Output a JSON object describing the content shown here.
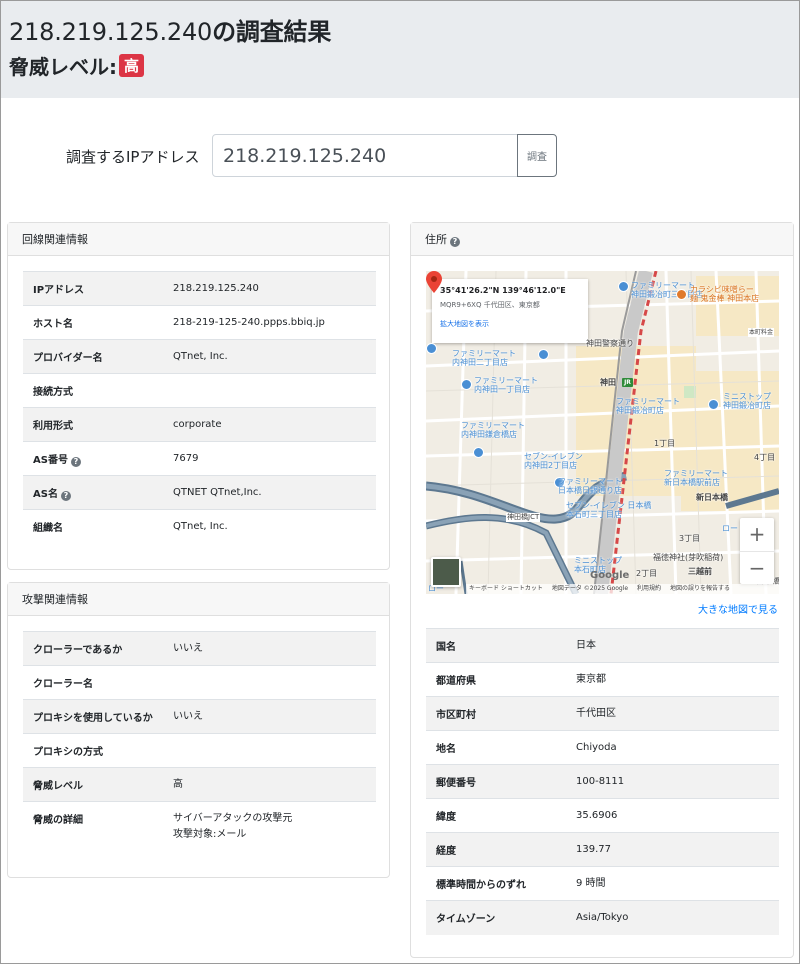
{
  "header": {
    "title_ip": "218.219.125.240",
    "title_suffix": "の調査結果",
    "threat_label": "脅威レベル:",
    "threat_badge": "高",
    "threat_badge_color": "#dc3545"
  },
  "search": {
    "label": "調査するIPアドレス",
    "value": "218.219.125.240",
    "button_label": "調査"
  },
  "line_info": {
    "title": "回線関連情報",
    "rows": [
      {
        "key": "IPアドレス",
        "value": "218.219.125.240"
      },
      {
        "key": "ホスト名",
        "value": "218-219-125-240.ppps.bbiq.jp"
      },
      {
        "key": "プロバイダー名",
        "value": "QTnet, Inc."
      },
      {
        "key": "接続方式",
        "value": ""
      },
      {
        "key": "利用形式",
        "value": "corporate"
      },
      {
        "key": "AS番号",
        "value": "7679",
        "help": "?"
      },
      {
        "key": "AS名",
        "value": "QTNET QTnet,Inc.",
        "help": "?"
      },
      {
        "key": "組織名",
        "value": "QTnet, Inc."
      }
    ]
  },
  "attack_info": {
    "title": "攻撃関連情報",
    "rows": [
      {
        "key": "クローラーであるか",
        "value": "いいえ"
      },
      {
        "key": "クローラー名",
        "value": ""
      },
      {
        "key": "プロキシを使用しているか",
        "value": "いいえ"
      },
      {
        "key": "プロキシの方式",
        "value": ""
      },
      {
        "key": "脅威レベル",
        "value": "高"
      },
      {
        "key": "脅威の詳細",
        "value": "サイバーアタックの攻撃元",
        "value2": "攻撃対象:メール"
      }
    ]
  },
  "address": {
    "title": "住所",
    "help": "?",
    "map": {
      "coords": "35°41'26.2\"N 139°46'12.0\"E",
      "plus_code": "MQR9+6XQ 千代田区、東京都",
      "enlarge_link": "拡大地図を表示",
      "zoom_in": "+",
      "zoom_out": "−",
      "logo": "Google",
      "footer": [
        "キーボード ショートカット",
        "地図データ ©2025 Google",
        "利用規約",
        "地図の誤りを報告する"
      ],
      "labels": {
        "famima_1": "ファミリーマート",
        "famima_1b": "神田鍛冶町三丁目店",
        "karashibi": "カラシビ味噌らー",
        "karashibi_b": "麺 鬼金棒 神田本店",
        "honmachi": "本町料金",
        "kandakeisatsu": "神田警察通り",
        "famima_2": "ファミリーマート",
        "famima_2b": "内神田二丁目店",
        "famima_3": "ファミリーマート",
        "famima_3b": "内神田一丁目店",
        "kanda": "神田",
        "jr": "JR",
        "famima_4": "ファミリーマート",
        "famima_4b": "神田鍛冶町店",
        "ministop_1": "ミニストップ",
        "ministop_1b": "神田鍛冶町店",
        "famima_5": "ファミリーマート",
        "famima_5b": "内神田鎌倉橋店",
        "seven_1": "セブン-イレブン",
        "seven_1b": "内神田2丁目店",
        "itchome": "1丁目",
        "yonchome": "4丁目",
        "famima_6": "ファミリーマート",
        "famima_6b": "日本橋日銀通り店",
        "famima_7": "ファミリーマート",
        "famima_7b": "新日本橋駅前店",
        "shinnihonbashi": "新日本橋",
        "seven_2": "セブン-イレブン 日本橋",
        "seven_2b": "本石町三丁目店",
        "kandabashi": "神田橋JCT",
        "sanchome": "3丁目",
        "fukutoku": "福徳神社(芽吹稲荷)",
        "ministop_2": "ミニストップ",
        "ministop_2b": "本石町店",
        "mitsukoshi": "三越前",
        "nichome": "2丁目",
        "nihonbashi": "日本橋",
        "lo": "ロー",
        "lo2": "ロー"
      }
    },
    "big_map_link": "大きな地図で見る",
    "rows": [
      {
        "key": "国名",
        "value": "日本"
      },
      {
        "key": "都道府県",
        "value": "東京都"
      },
      {
        "key": "市区町村",
        "value": "千代田区"
      },
      {
        "key": "地名",
        "value": "Chiyoda"
      },
      {
        "key": "郵便番号",
        "value": "100-8111"
      },
      {
        "key": "緯度",
        "value": "35.6906"
      },
      {
        "key": "経度",
        "value": "139.77"
      },
      {
        "key": "標準時間からのずれ",
        "value": "9 時間"
      },
      {
        "key": "タイムゾーン",
        "value": "Asia/Tokyo"
      }
    ]
  }
}
